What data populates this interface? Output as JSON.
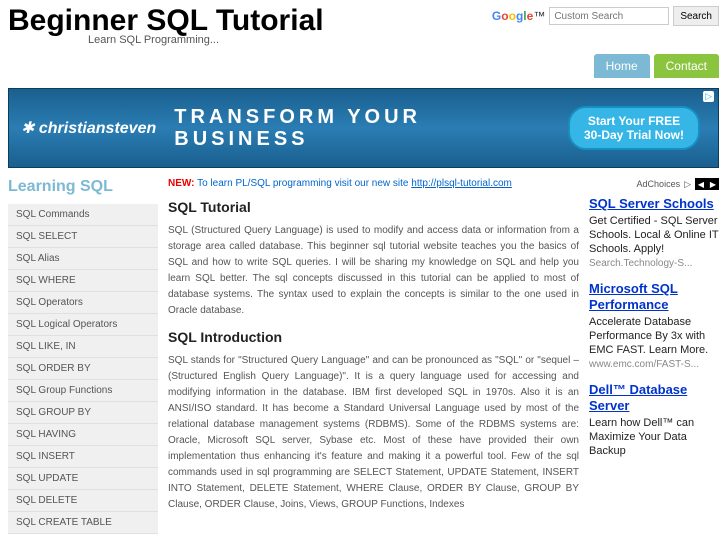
{
  "header": {
    "title": "Beginner SQL Tutorial",
    "tagline": "Learn SQL Programming...",
    "search_placeholder": "Custom Search",
    "search_button": "Search"
  },
  "nav": {
    "home": "Home",
    "contact": "Contact"
  },
  "banner": {
    "logo": "christiansteven",
    "line1": "TRANSFORM YOUR",
    "line2": "BUSINESS",
    "cta1": "Start Your FREE",
    "cta2": "30-Day Trial Now!",
    "ad_marker": "▷"
  },
  "sidebar": {
    "title": "Learning SQL",
    "items": [
      "SQL Commands",
      "SQL SELECT",
      "SQL Alias",
      "SQL WHERE",
      "SQL Operators",
      "SQL Logical Operators",
      "SQL LIKE, IN",
      "SQL ORDER BY",
      "SQL Group Functions",
      "SQL GROUP BY",
      "SQL HAVING",
      "SQL INSERT",
      "SQL UPDATE",
      "SQL DELETE",
      "SQL CREATE TABLE"
    ]
  },
  "main": {
    "new_tag": "NEW:",
    "new_text": "To learn PL/SQL programming visit our new site ",
    "new_link": "http://plsql-tutorial.com",
    "h1": "SQL Tutorial",
    "p1": "SQL (Structured Query Language) is used to modify and access data or information from a storage area called database. This beginner sql tutorial website teaches you the basics of SQL and how to write SQL queries. I will be sharing my knowledge on SQL and help you learn SQL better. The sql concepts discussed in this tutorial can be applied to most of database systems. The syntax used to explain the concepts is similar to the one used in Oracle database.",
    "h2": "SQL Introduction",
    "p2": "SQL stands for \"Structured Query Language\" and can be pronounced as \"SQL\" or \"sequel – (Structured English Query Language)\". It is a query language used for accessing and modifying information in the database. IBM first developed SQL in 1970s. Also it is an ANSI/ISO standard. It has become a Standard Universal Language used by most of the relational database management systems (RDBMS). Some of the RDBMS systems are: Oracle, Microsoft SQL server, Sybase etc. Most of these have provided their own implementation thus enhancing it's feature and making it a powerful tool. Few of the sql commands used in sql programming are SELECT Statement, UPDATE Statement, INSERT INTO Statement, DELETE Statement, WHERE Clause, ORDER BY Clause, GROUP BY Clause, ORDER Clause, Joins, Views, GROUP Functions, Indexes"
  },
  "adchoices": {
    "label": "AdChoices",
    "arrow": "▷"
  },
  "ads": [
    {
      "title": "SQL Server Schools",
      "desc": "Get Certified - SQL Server Schools. Local & Online IT Schools. Apply!",
      "url": "Search.Technology-S..."
    },
    {
      "title": "Microsoft SQL Performance",
      "desc": "Accelerate Database Performance By 3x with EMC FAST. Learn More.",
      "url": "www.emc.com/FAST-S..."
    },
    {
      "title": "Dell™ Database Server",
      "desc": "Learn how Dell™ can Maximize Your Data Backup",
      "url": ""
    }
  ]
}
